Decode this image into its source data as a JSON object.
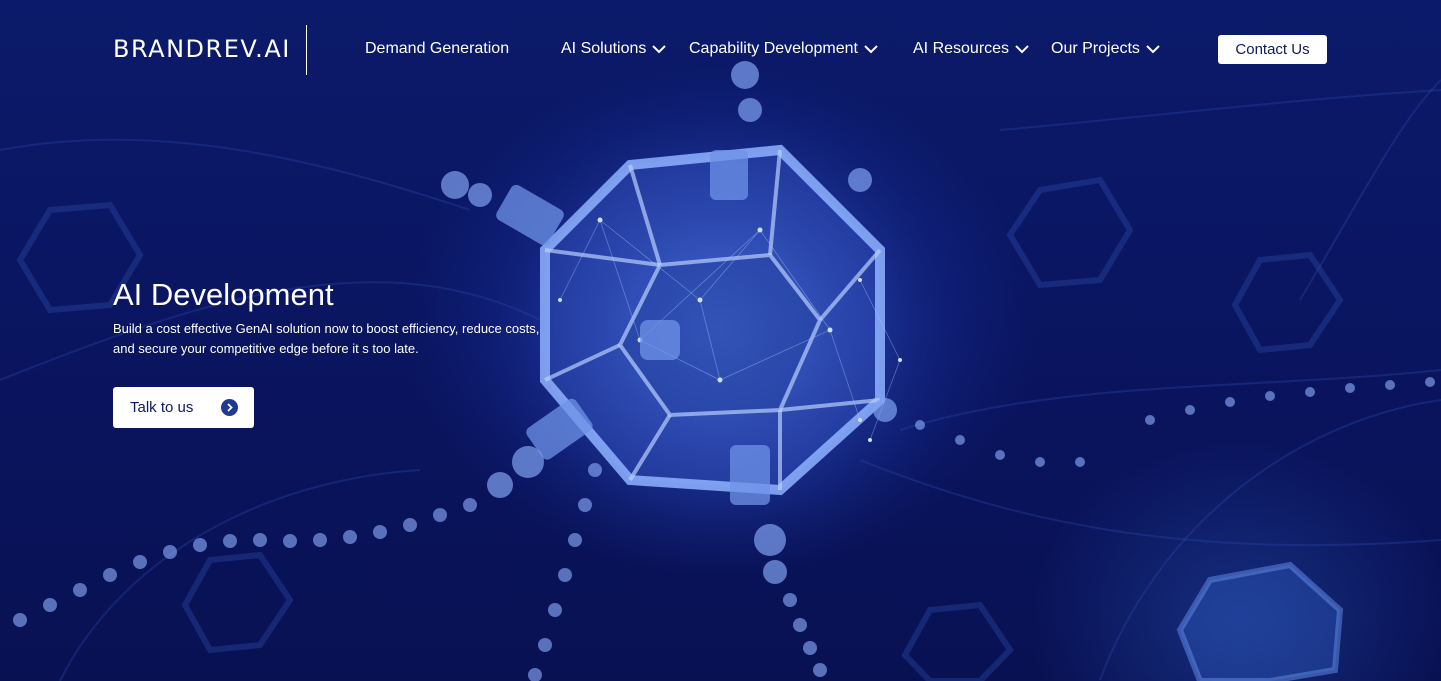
{
  "brand": {
    "logo_text": "BRANDREV.AI"
  },
  "nav": {
    "items": [
      {
        "label": "Demand Generation",
        "has_dropdown": false
      },
      {
        "label": "AI Solutions",
        "has_dropdown": true
      },
      {
        "label": "Capability Development",
        "has_dropdown": true
      },
      {
        "label": "AI Resources",
        "has_dropdown": true
      },
      {
        "label": "Our Projects",
        "has_dropdown": true
      }
    ],
    "contact_label": "Contact Us"
  },
  "hero": {
    "title": "AI Development",
    "subtitle": "Build a cost effective GenAI solution now to boost efficiency, reduce costs, and secure your competitive edge before it s too late.",
    "cta_label": "Talk to us",
    "cta_icon": "arrow-right-circle-icon"
  },
  "colors": {
    "background": "#0a1560",
    "accent_glow": "#1d3a9e",
    "text": "#ffffff",
    "button_bg": "#ffffff",
    "button_text": "#0d1b5e",
    "cta_icon_bg": "#1f3a93"
  }
}
